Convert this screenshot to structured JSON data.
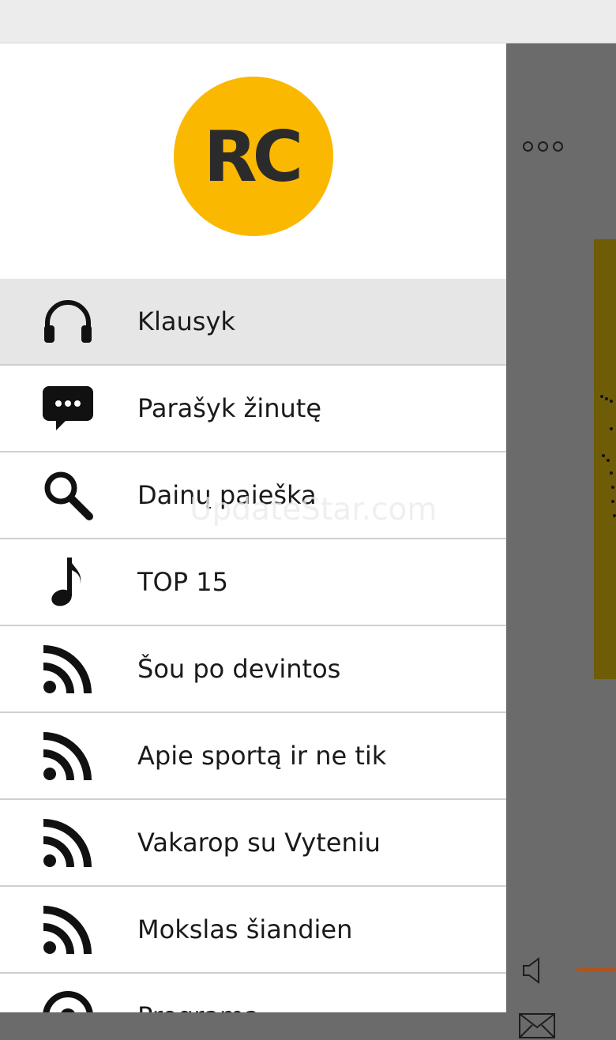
{
  "logo": {
    "text": "RC",
    "color": "#fbb800"
  },
  "menu": {
    "items": [
      {
        "label": "Klausyk",
        "icon": "headphones-icon",
        "active": true
      },
      {
        "label": "Parašyk žinutę",
        "icon": "chat-bubble-icon"
      },
      {
        "label": "Dainų paieška",
        "icon": "search-icon"
      },
      {
        "label": "TOP 15",
        "icon": "music-note-icon"
      },
      {
        "label": "Šou po devintos",
        "icon": "rss-icon"
      },
      {
        "label": "Apie sportą ir ne tik",
        "icon": "rss-icon"
      },
      {
        "label": "Vakarop su Vyteniu",
        "icon": "rss-icon"
      },
      {
        "label": "Mokslas šiandien",
        "icon": "rss-icon"
      },
      {
        "label": "Programa",
        "icon": "broadcast-icon"
      }
    ]
  },
  "background_app": {
    "more_icon": "more-options-icon",
    "volume_icon": "volume-icon",
    "mail_icon": "mail-icon",
    "accent_color": "#b3541d"
  },
  "watermark": "UpdateStar.com"
}
